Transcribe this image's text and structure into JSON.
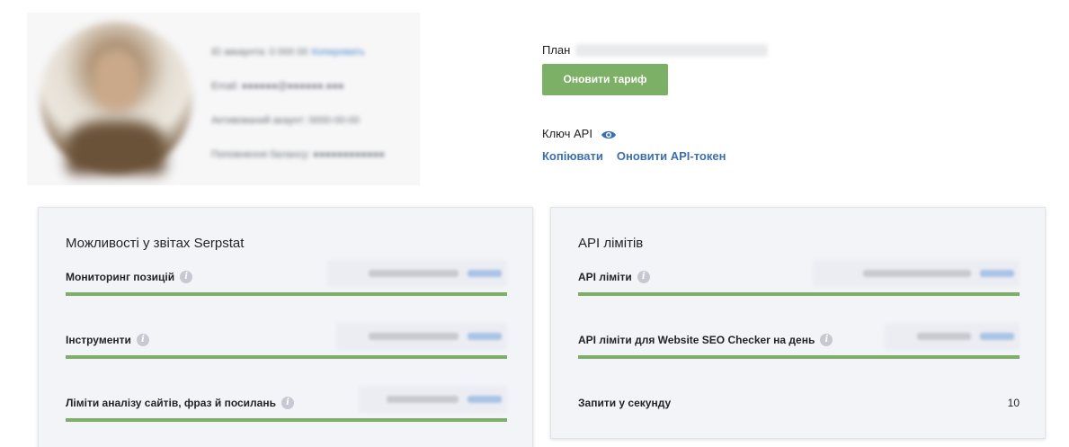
{
  "profile": {
    "lines": [
      {
        "text": "ID аккаунта: 0 000 00",
        "link": "Копировать"
      },
      {
        "text": "Email: ●●●●●●@●●●●●●.●●●",
        "link": ""
      },
      {
        "text": "Активований акаунт: 0000-00-00",
        "link": ""
      },
      {
        "text": "Поповнення балансу: ●●●●●●●●●●●●",
        "link": ""
      }
    ]
  },
  "plan": {
    "label": "План",
    "upgrade_button": "Оновити тариф"
  },
  "api_key": {
    "label": "Ключ API",
    "copy_link": "Копіювати",
    "refresh_link": "Оновити API-токен"
  },
  "reports_card": {
    "title": "Можливості у звітах Serpstat",
    "rows": [
      {
        "label": "Мониторинг позицій",
        "progress": 1.0
      },
      {
        "label": "Інструменти",
        "progress": 1.0
      },
      {
        "label": "Ліміти аналізу сайтів, фраз й посилань",
        "progress": 1.0
      }
    ]
  },
  "api_card": {
    "title": "API лімітів",
    "rows": [
      {
        "label": "API ліміти",
        "progress": 1.0
      },
      {
        "label": "API ліміти для Website SEO Checker на день",
        "progress": 1.0
      }
    ],
    "rps_label": "Запити у секунду",
    "rps_value": "10"
  },
  "colors": {
    "accent_green": "#7cb066",
    "link_blue": "#3b6fae"
  }
}
